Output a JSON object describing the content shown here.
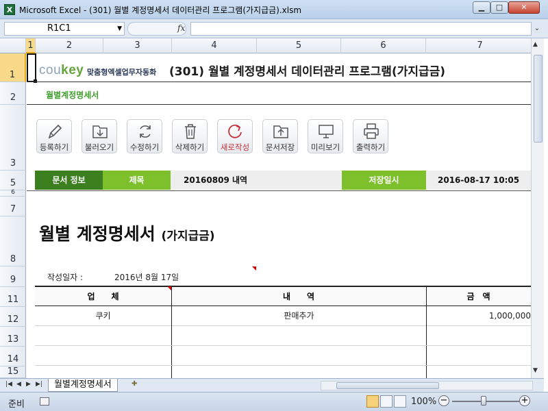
{
  "window": {
    "title": "Microsoft Excel - (301) 월별 계정명세서 데이터관리 프로그램(가지급금).xlsm",
    "app_icon": "X"
  },
  "formula_bar": {
    "name_box": "R1C1",
    "fx_label": "fx",
    "formula": ""
  },
  "columns": [
    "1",
    "2",
    "3",
    "4",
    "5",
    "6",
    "7"
  ],
  "rows": [
    "1",
    "2",
    "3",
    "5",
    "6",
    "7",
    "8",
    "9",
    "11",
    "12",
    "13",
    "14",
    "15"
  ],
  "sheet": {
    "logo_text": "coukey",
    "logo_sub": "맞춤형엑셀업무자동화",
    "program_title": "(301) 월별 계정명세서 데이터관리 프로그램(가지급금)",
    "sheet_label": "월별계정명세서",
    "toolbar": [
      {
        "label": "등록하기",
        "icon": "pencil-icon"
      },
      {
        "label": "불러오기",
        "icon": "folder-download-icon"
      },
      {
        "label": "수정하기",
        "icon": "refresh-icon"
      },
      {
        "label": "삭제하기",
        "icon": "trash-icon"
      },
      {
        "label": "새로작성",
        "icon": "new-document-icon"
      },
      {
        "label": "문서저장",
        "icon": "folder-upload-icon"
      },
      {
        "label": "미리보기",
        "icon": "monitor-icon"
      },
      {
        "label": "출력하기",
        "icon": "printer-icon"
      }
    ],
    "info": {
      "doc_info": "문서 정보",
      "subject_label": "제목",
      "subject_value": "20160809 내역",
      "saved_label": "저장일시",
      "saved_value": "2016-08-17 10:05"
    },
    "doc_title": "월별 계정명세서",
    "doc_title_sub": "(가지급금)",
    "date_label": "작성일자 :",
    "date_value": "2016년 8월 17일",
    "table": {
      "headers": [
        "업　　체",
        "내　　역",
        "금　액"
      ],
      "rows": [
        [
          "쿠키",
          "판매추가",
          "1,000,000"
        ]
      ]
    }
  },
  "tabs": {
    "sheet_tab": "월별계정명세서"
  },
  "status": {
    "ready": "준비",
    "zoom": "100%"
  },
  "colors": {
    "dark_green": "#3b7f1e",
    "light_green": "#7dc02c",
    "accent_red": "#c7313a"
  }
}
